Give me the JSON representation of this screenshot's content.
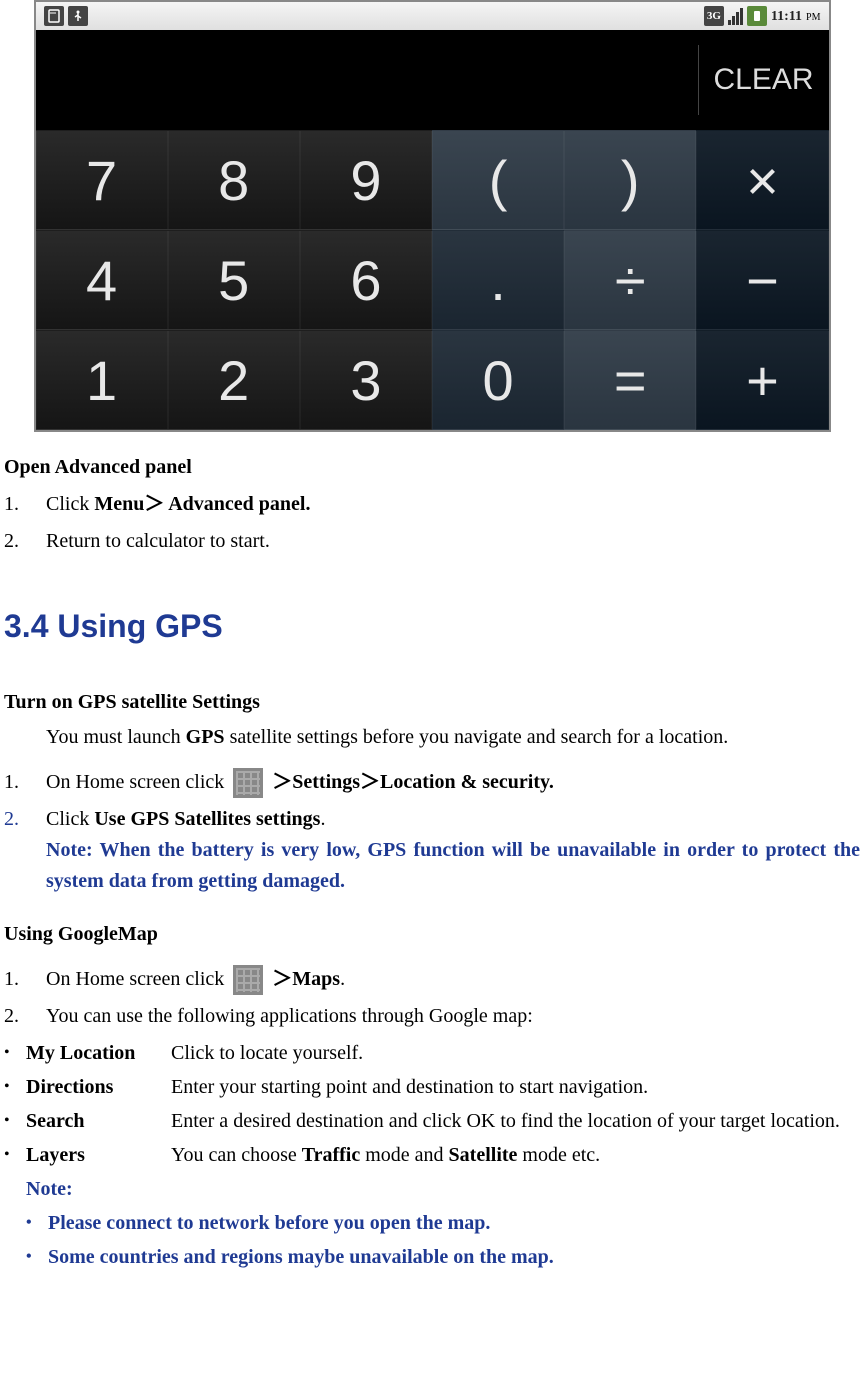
{
  "status_bar": {
    "time": "11:11",
    "period": "PM",
    "network": "3G"
  },
  "calculator": {
    "clear_label": "CLEAR",
    "row1": [
      "7",
      "8",
      "9",
      "(",
      ")",
      "×"
    ],
    "row2": [
      "4",
      "5",
      "6",
      ".",
      "÷",
      "−"
    ],
    "row3": [
      "1",
      "2",
      "3",
      "0",
      "=",
      "+"
    ]
  },
  "doc": {
    "advanced": {
      "title": "Open Advanced panel",
      "step1_pre": "Click ",
      "step1_bold": "Menu＞ Advanced panel.",
      "step2": "Return to calculator to start."
    },
    "heading": "3.4 Using GPS",
    "gps": {
      "title": "Turn on GPS satellite Settings",
      "intro_pre": "You must launch ",
      "intro_bold": "GPS",
      "intro_post": " satellite settings before you navigate and search for a location.",
      "step1_pre": "On Home screen click ",
      "step1_bold": " ＞Settings＞Location & security.",
      "step2_pre": "Click ",
      "step2_bold": "Use GPS Satellites settings",
      "step2_post": ".",
      "note_label": "Note:   ",
      "note_text": "When the battery is very low, GPS function will be unavailable in order to protect the system data from getting damaged."
    },
    "map": {
      "title": "Using GoogleMap",
      "step1_pre": "On Home screen click ",
      "step1_bold": " ＞Maps",
      "step1_post": ".",
      "step2": "You can use the following applications through Google map:",
      "items": [
        {
          "label": "My Location",
          "desc": "Click to locate yourself."
        },
        {
          "label": "Directions",
          "desc": "Enter your starting point and destination to start navigation."
        },
        {
          "label": "Search",
          "desc": "Enter a desired destination and click OK to find the location of your target location."
        },
        {
          "label": "Layers",
          "desc_pre": "You can choose ",
          "desc_b1": "Traffic",
          "desc_mid": " mode and ",
          "desc_b2": "Satellite",
          "desc_post": " mode etc."
        }
      ],
      "note_label": "Note:",
      "note1": "Please connect to network before you open the map.",
      "note2": "Some countries and regions maybe unavailable on the map."
    }
  }
}
